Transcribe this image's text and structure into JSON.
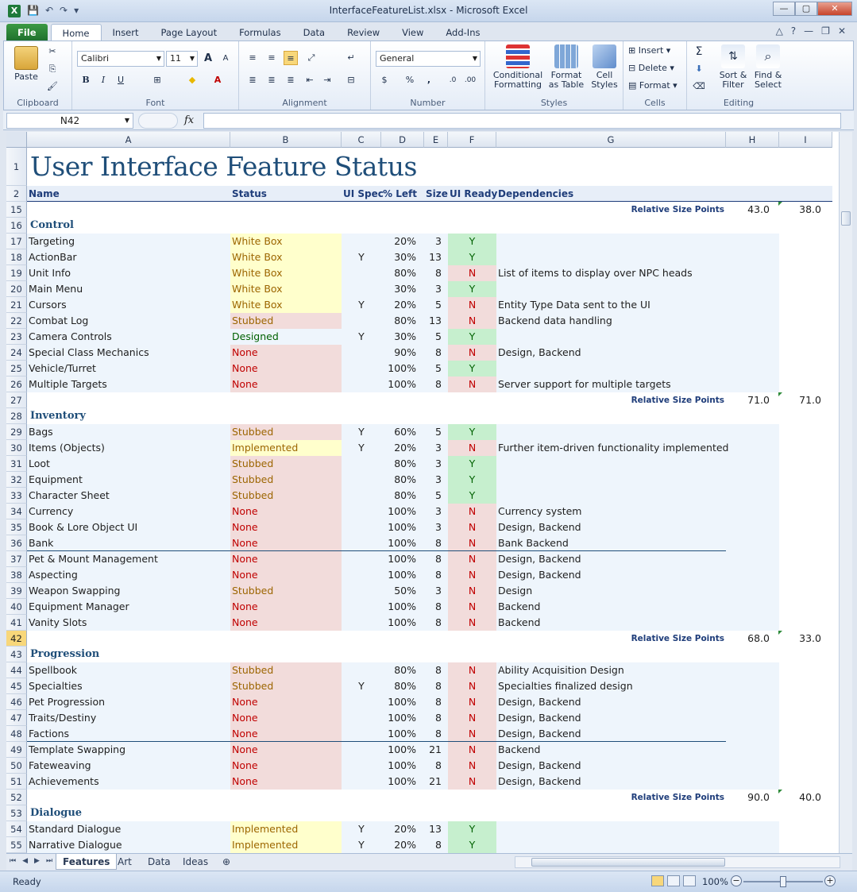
{
  "window": {
    "title": "InterfaceFeatureList.xlsx - Microsoft Excel",
    "app_icon": "X",
    "min": "—",
    "max": "▢",
    "close": "✕"
  },
  "tabs": [
    "File",
    "Home",
    "Insert",
    "Page Layout",
    "Formulas",
    "Data",
    "Review",
    "View",
    "Add-Ins"
  ],
  "ribbon": {
    "clipboard": {
      "label": "Clipboard",
      "paste": "Paste"
    },
    "font": {
      "label": "Font",
      "name": "Calibri",
      "size": "11",
      "bold": "B",
      "italic": "I",
      "underline": "U",
      "grow": "A",
      "shrink": "A"
    },
    "alignment": {
      "label": "Alignment"
    },
    "number": {
      "label": "Number",
      "format": "General",
      "currency": "$",
      "percent": "%",
      "comma": ","
    },
    "styles": {
      "label": "Styles",
      "conditional": "Conditional Formatting",
      "astable": "Format as Table",
      "cellstyles": "Cell Styles"
    },
    "cells": {
      "label": "Cells",
      "insert": "Insert",
      "delete": "Delete",
      "format": "Format"
    },
    "editing": {
      "label": "Editing",
      "sum": "Σ",
      "sortfilter": "Sort & Filter",
      "findselect": "Find & Select"
    }
  },
  "formula_bar": {
    "name_box": "N42",
    "fx": "fx",
    "value": ""
  },
  "columns": [
    {
      "key": "A",
      "label": "A"
    },
    {
      "key": "B",
      "label": "B"
    },
    {
      "key": "C",
      "label": "C"
    },
    {
      "key": "D",
      "label": "D"
    },
    {
      "key": "E",
      "label": "E"
    },
    {
      "key": "F",
      "label": "F"
    },
    {
      "key": "G",
      "label": "G"
    },
    {
      "key": "H",
      "label": "H"
    },
    {
      "key": "I",
      "label": "I"
    }
  ],
  "sheet": {
    "title": "User Interface Feature Status",
    "headers": {
      "name": "Name",
      "status": "Status",
      "uispec": "UI Spec",
      "pctleft": "% Left",
      "size": "Size",
      "uiready": "UI Ready",
      "deps": "Dependencies"
    },
    "rel_label": "Relative Size Points",
    "rows": [
      {
        "n": "15",
        "kind": "rel",
        "h": "43.0",
        "i": "38.0"
      },
      {
        "n": "16",
        "kind": "section",
        "name": "Control"
      },
      {
        "n": "17",
        "kind": "item",
        "name": "Targeting",
        "status": "White Box",
        "spec": "",
        "pct": "20%",
        "size": "3",
        "ready": "Y",
        "deps": ""
      },
      {
        "n": "18",
        "kind": "item",
        "name": "ActionBar",
        "status": "White Box",
        "spec": "Y",
        "pct": "30%",
        "size": "13",
        "ready": "Y",
        "deps": ""
      },
      {
        "n": "19",
        "kind": "item",
        "name": "Unit Info",
        "status": "White Box",
        "spec": "",
        "pct": "80%",
        "size": "8",
        "ready": "N",
        "deps": "List of items to display over NPC heads"
      },
      {
        "n": "20",
        "kind": "item",
        "name": "Main Menu",
        "status": "White Box",
        "spec": "",
        "pct": "30%",
        "size": "3",
        "ready": "Y",
        "deps": ""
      },
      {
        "n": "21",
        "kind": "item",
        "name": "Cursors",
        "status": "White Box",
        "spec": "Y",
        "pct": "20%",
        "size": "5",
        "ready": "N",
        "deps": "Entity Type Data sent to the UI"
      },
      {
        "n": "22",
        "kind": "item",
        "name": "Combat Log",
        "status": "Stubbed",
        "spec": "",
        "pct": "80%",
        "size": "13",
        "ready": "N",
        "deps": "Backend data handling"
      },
      {
        "n": "23",
        "kind": "item",
        "name": "Camera Controls",
        "status": "Designed",
        "spec": "Y",
        "pct": "30%",
        "size": "5",
        "ready": "Y",
        "deps": ""
      },
      {
        "n": "24",
        "kind": "item",
        "name": "Special Class Mechanics",
        "status": "None",
        "spec": "",
        "pct": "90%",
        "size": "8",
        "ready": "N",
        "deps": "Design, Backend"
      },
      {
        "n": "25",
        "kind": "item",
        "name": "Vehicle/Turret",
        "status": "None",
        "spec": "",
        "pct": "100%",
        "size": "5",
        "ready": "Y",
        "deps": ""
      },
      {
        "n": "26",
        "kind": "item",
        "name": "Multiple Targets",
        "status": "None",
        "spec": "",
        "pct": "100%",
        "size": "8",
        "ready": "N",
        "deps": "Server support for multiple targets"
      },
      {
        "n": "27",
        "kind": "rel",
        "h": "71.0",
        "i": "71.0"
      },
      {
        "n": "28",
        "kind": "section",
        "name": "Inventory"
      },
      {
        "n": "29",
        "kind": "item",
        "name": "Bags",
        "status": "Stubbed",
        "spec": "Y",
        "pct": "60%",
        "size": "5",
        "ready": "Y",
        "deps": ""
      },
      {
        "n": "30",
        "kind": "item",
        "name": "Items (Objects)",
        "status": "Implemented",
        "spec": "Y",
        "pct": "20%",
        "size": "3",
        "ready": "N",
        "deps": "Further item-driven functionality implemented"
      },
      {
        "n": "31",
        "kind": "item",
        "name": "Loot",
        "status": "Stubbed",
        "spec": "",
        "pct": "80%",
        "size": "3",
        "ready": "Y",
        "deps": ""
      },
      {
        "n": "32",
        "kind": "item",
        "name": "Equipment",
        "status": "Stubbed",
        "spec": "",
        "pct": "80%",
        "size": "3",
        "ready": "Y",
        "deps": ""
      },
      {
        "n": "33",
        "kind": "item",
        "name": "Character Sheet",
        "status": "Stubbed",
        "spec": "",
        "pct": "80%",
        "size": "5",
        "ready": "Y",
        "deps": ""
      },
      {
        "n": "34",
        "kind": "item",
        "name": "Currency",
        "status": "None",
        "spec": "",
        "pct": "100%",
        "size": "3",
        "ready": "N",
        "deps": "Currency system"
      },
      {
        "n": "35",
        "kind": "item",
        "name": "Book & Lore Object UI",
        "status": "None",
        "spec": "",
        "pct": "100%",
        "size": "3",
        "ready": "N",
        "deps": "Design, Backend"
      },
      {
        "n": "36",
        "kind": "item",
        "name": "Bank",
        "status": "None",
        "spec": "",
        "pct": "100%",
        "size": "8",
        "ready": "N",
        "deps": "Bank Backend",
        "line": true
      },
      {
        "n": "37",
        "kind": "item",
        "name": "Pet & Mount Management",
        "status": "None",
        "spec": "",
        "pct": "100%",
        "size": "8",
        "ready": "N",
        "deps": "Design, Backend"
      },
      {
        "n": "38",
        "kind": "item",
        "name": "Aspecting",
        "status": "None",
        "spec": "",
        "pct": "100%",
        "size": "8",
        "ready": "N",
        "deps": "Design, Backend"
      },
      {
        "n": "39",
        "kind": "item",
        "name": "Weapon Swapping",
        "status": "Stubbed",
        "spec": "",
        "pct": "50%",
        "size": "3",
        "ready": "N",
        "deps": "Design"
      },
      {
        "n": "40",
        "kind": "item",
        "name": "Equipment Manager",
        "status": "None",
        "spec": "",
        "pct": "100%",
        "size": "8",
        "ready": "N",
        "deps": "Backend"
      },
      {
        "n": "41",
        "kind": "item",
        "name": "Vanity Slots",
        "status": "None",
        "spec": "",
        "pct": "100%",
        "size": "8",
        "ready": "N",
        "deps": "Backend"
      },
      {
        "n": "42",
        "kind": "rel",
        "h": "68.0",
        "i": "33.0",
        "selected": true
      },
      {
        "n": "43",
        "kind": "section",
        "name": "Progression"
      },
      {
        "n": "44",
        "kind": "item",
        "name": "Spellbook",
        "status": "Stubbed",
        "spec": "",
        "pct": "80%",
        "size": "8",
        "ready": "N",
        "deps": "Ability Acquisition Design"
      },
      {
        "n": "45",
        "kind": "item",
        "name": "Specialties",
        "status": "Stubbed",
        "spec": "Y",
        "pct": "80%",
        "size": "8",
        "ready": "N",
        "deps": "Specialties finalized design"
      },
      {
        "n": "46",
        "kind": "item",
        "name": "Pet Progression",
        "status": "None",
        "spec": "",
        "pct": "100%",
        "size": "8",
        "ready": "N",
        "deps": "Design, Backend"
      },
      {
        "n": "47",
        "kind": "item",
        "name": "Traits/Destiny",
        "status": "None",
        "spec": "",
        "pct": "100%",
        "size": "8",
        "ready": "N",
        "deps": "Design, Backend"
      },
      {
        "n": "48",
        "kind": "item",
        "name": "Factions",
        "status": "None",
        "spec": "",
        "pct": "100%",
        "size": "8",
        "ready": "N",
        "deps": "Design, Backend",
        "line": true
      },
      {
        "n": "49",
        "kind": "item",
        "name": "Template Swapping",
        "status": "None",
        "spec": "",
        "pct": "100%",
        "size": "21",
        "ready": "N",
        "deps": "Backend"
      },
      {
        "n": "50",
        "kind": "item",
        "name": "Fateweaving",
        "status": "None",
        "spec": "",
        "pct": "100%",
        "size": "8",
        "ready": "N",
        "deps": "Design, Backend"
      },
      {
        "n": "51",
        "kind": "item",
        "name": "Achievements",
        "status": "None",
        "spec": "",
        "pct": "100%",
        "size": "21",
        "ready": "N",
        "deps": "Design, Backend"
      },
      {
        "n": "52",
        "kind": "rel",
        "h": "90.0",
        "i": "40.0"
      },
      {
        "n": "53",
        "kind": "section",
        "name": "Dialogue"
      },
      {
        "n": "54",
        "kind": "item",
        "name": "Standard Dialogue",
        "status": "Implemented",
        "spec": "Y",
        "pct": "20%",
        "size": "13",
        "ready": "Y",
        "deps": ""
      },
      {
        "n": "55",
        "kind": "item",
        "name": "Narrative Dialogue",
        "status": "Implemented",
        "spec": "Y",
        "pct": "20%",
        "size": "8",
        "ready": "Y",
        "deps": ""
      }
    ]
  },
  "sheet_tabs": [
    "Features",
    "Art",
    "Data",
    "Ideas"
  ],
  "status_bar": {
    "ready": "Ready",
    "zoom": "100%"
  },
  "colors": {
    "title": "#1f4e79",
    "header": "#1f3d7a",
    "whitebox_bg": "#ffffcc",
    "whitebox_fg": "#9c6500",
    "stubbed_bg": "#f2dcdb",
    "stubbed_fg": "#9c6500",
    "none_fg": "#c00000",
    "designed_fg": "#006100",
    "ready_y_bg": "#c6efce",
    "ready_y_fg": "#006100",
    "ready_n_bg": "#f2dcdb",
    "ready_n_fg": "#c00000",
    "row_bg": "#eef5fc"
  }
}
